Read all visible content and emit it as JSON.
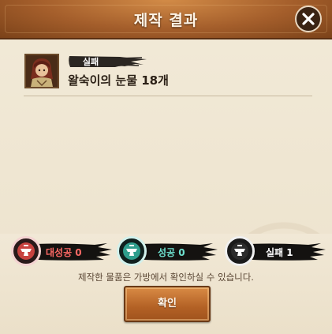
{
  "dialog": {
    "title": "제작 결과",
    "close_icon": "close-x-icon"
  },
  "result": {
    "status": "실패",
    "item_name": "왈숙이의 눈물 18개",
    "item_icon": "character-portrait-icon"
  },
  "stats": [
    {
      "label": "대성공 0",
      "color": "#e05a57",
      "icon": "anvil-icon-red"
    },
    {
      "label": "성공 0",
      "color": "#5fd3c0",
      "icon": "anvil-icon-teal"
    },
    {
      "label": "실패 1",
      "color": "#ffffff",
      "icon": "anvil-icon-white"
    }
  ],
  "notice": "제작한 물품은 가방에서 확인하실 수 있습니다.",
  "confirm_label": "확인",
  "colors": {
    "header": "#a45e2b",
    "button": "#b36125",
    "success_great": "#e05a57",
    "success": "#5fd3c0"
  }
}
